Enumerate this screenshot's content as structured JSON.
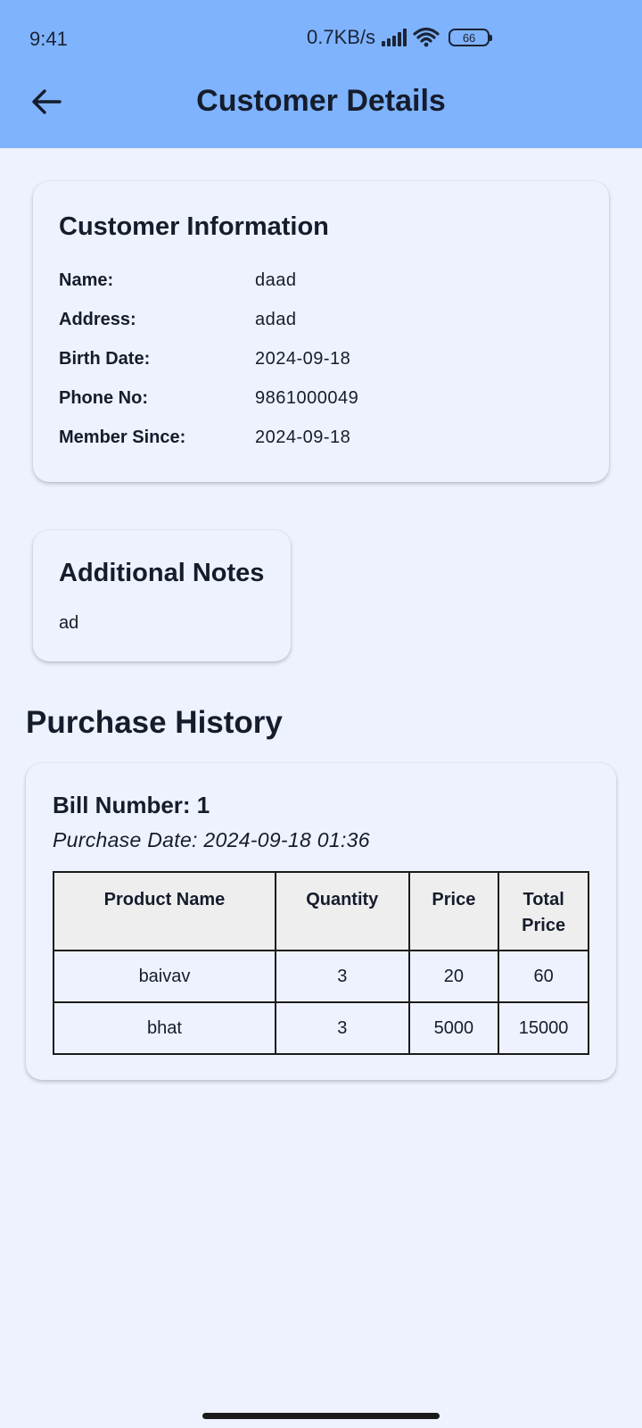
{
  "status_bar": {
    "time": "9:41",
    "network_speed": "0.7KB/s",
    "battery": "66",
    "icons": [
      "signal-icon",
      "wifi-icon",
      "battery-icon"
    ]
  },
  "app_bar": {
    "title": "Customer Details",
    "back_icon": "arrow-left-icon",
    "background_color": "#7fb3fd"
  },
  "customer_info": {
    "title": "Customer Information",
    "rows": [
      {
        "label": "Name:",
        "value": "daad"
      },
      {
        "label": "Address:",
        "value": "adad"
      },
      {
        "label": "Birth Date:",
        "value": "2024-09-18"
      },
      {
        "label": "Phone No:",
        "value": "9861000049"
      },
      {
        "label": "Member Since:",
        "value": "2024-09-18"
      }
    ]
  },
  "notes": {
    "title": "Additional Notes",
    "text": "ad"
  },
  "purchase_history": {
    "title": "Purchase History",
    "bills": [
      {
        "bill_number": "Bill Number: 1",
        "purchase_date": "Purchase Date: 2024-09-18 01:36",
        "columns": [
          "Product Name",
          "Quantity",
          "Price",
          "Total Price"
        ],
        "rows": [
          [
            "baivav",
            "3",
            "20",
            "60"
          ],
          [
            "bhat",
            "3",
            "5000",
            "15000"
          ]
        ]
      }
    ]
  },
  "colors": {
    "page_background": "#eef2fe",
    "text": "#151c2c",
    "table_header_background": "#eeeeee"
  }
}
